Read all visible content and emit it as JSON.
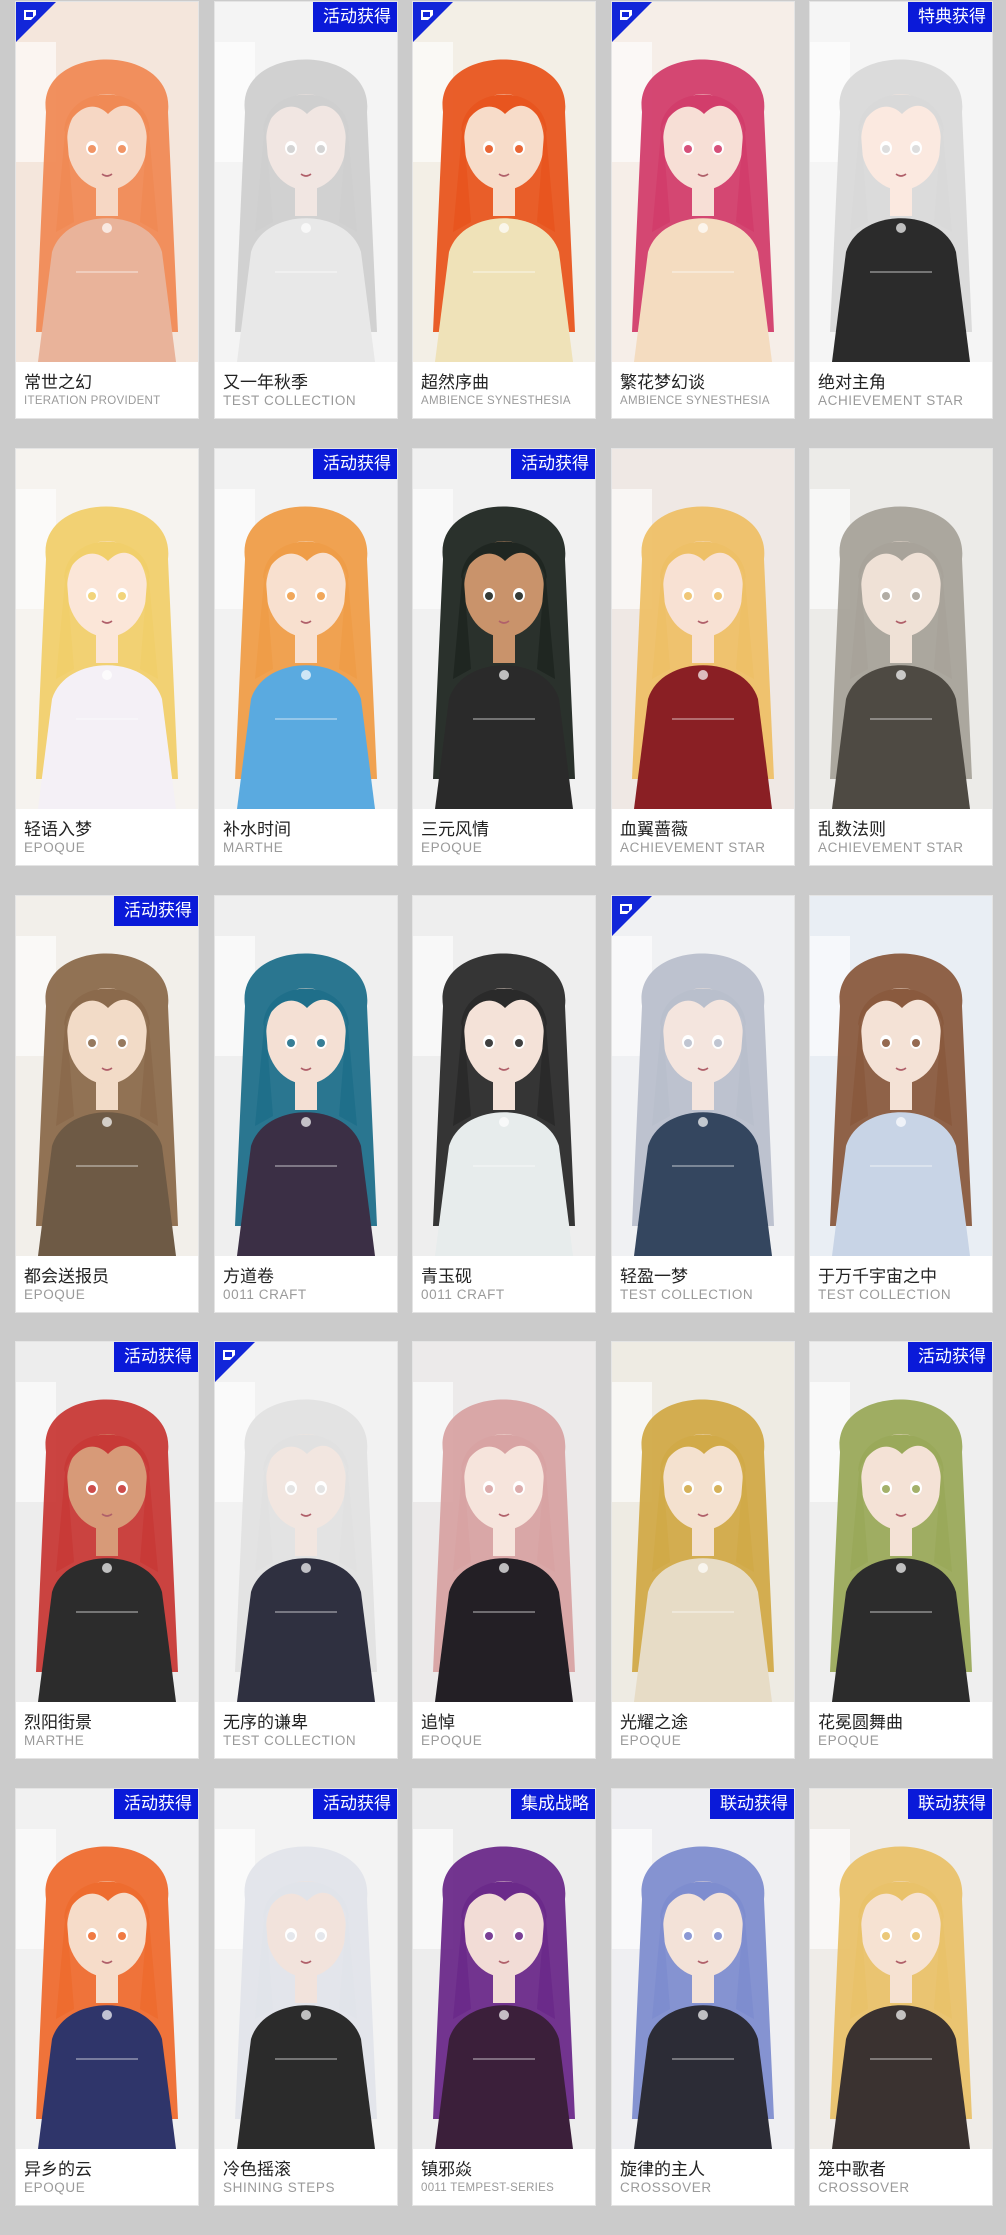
{
  "badges": {
    "event": "活动获得",
    "classic": "特典获得",
    "integrated": "集成战略",
    "collab": "联动获得"
  },
  "cards": [
    {
      "name": "常世之幻",
      "brand": "ITERATION PROVIDENT",
      "badge": "",
      "corner": true,
      "hair": "#f08a55",
      "skin": "#f6d7c4",
      "outfit": "#e9b39a",
      "bg": "#f4e6dc"
    },
    {
      "name": "又一年秋季",
      "brand": "TEST COLLECTION",
      "badge": "event",
      "corner": false,
      "hair": "#cfcfcf",
      "skin": "#f1e6e2",
      "outfit": "#e8e8e8",
      "bg": "#f4f4f4"
    },
    {
      "name": "超然序曲",
      "brand": "AMBIENCE SYNESTHESIA",
      "badge": "",
      "corner": true,
      "hair": "#e8551f",
      "skin": "#f7dcc9",
      "outfit": "#efe2b8",
      "bg": "#f3efe6"
    },
    {
      "name": "繁花梦幻谈",
      "brand": "AMBIENCE SYNESTHESIA",
      "badge": "",
      "corner": true,
      "hair": "#d23d6b",
      "skin": "#f7dfd6",
      "outfit": "#f4dcc0",
      "bg": "#f6eee8"
    },
    {
      "name": "绝对主角",
      "brand": "ACHIEVEMENT STAR",
      "badge": "classic",
      "corner": false,
      "hair": "#d9d9d9",
      "skin": "#fbe9e0",
      "outfit": "#2b2b2b",
      "bg": "#f5f5f5"
    },
    {
      "name": "轻语入梦",
      "brand": "EPOQUE",
      "badge": "",
      "corner": false,
      "hair": "#f1cf6b",
      "skin": "#fbe6d8",
      "outfit": "#f4f0f6",
      "bg": "#f6f3ef"
    },
    {
      "name": "补水时间",
      "brand": "MARTHE",
      "badge": "event",
      "corner": false,
      "hair": "#ef9d48",
      "skin": "#f8e0cf",
      "outfit": "#5aaae0",
      "bg": "#f2f2f2"
    },
    {
      "name": "三元风情",
      "brand": "EPOQUE",
      "badge": "event",
      "corner": false,
      "hair": "#1f2621",
      "skin": "#c9936b",
      "outfit": "#2a2a2a",
      "bg": "#f1f1f1"
    },
    {
      "name": "血翼蔷薇",
      "brand": "ACHIEVEMENT STAR",
      "badge": "",
      "corner": false,
      "hair": "#eec067",
      "skin": "#f8e1d3",
      "outfit": "#8a1f24",
      "bg": "#efe8e4"
    },
    {
      "name": "乱数法则",
      "brand": "ACHIEVEMENT STAR",
      "badge": "",
      "corner": false,
      "hair": "#a8a39a",
      "skin": "#efe1d6",
      "outfit": "#4e4a43",
      "bg": "#ecebe8"
    },
    {
      "name": "都会送报员",
      "brand": "EPOQUE",
      "badge": "event",
      "corner": false,
      "hair": "#8b6a4c",
      "skin": "#f2dbc7",
      "outfit": "#6e5a45",
      "bg": "#f2efea"
    },
    {
      "name": "方道卷",
      "brand": "0011 CRAFT",
      "badge": "",
      "corner": false,
      "hair": "#1f6f8a",
      "skin": "#f4e0d4",
      "outfit": "#3b2f45",
      "bg": "#efefef"
    },
    {
      "name": "青玉砚",
      "brand": "0011 CRAFT",
      "badge": "",
      "corner": false,
      "hair": "#2a2a2a",
      "skin": "#f4e2d8",
      "outfit": "#e7ecec",
      "bg": "#eeeeee"
    },
    {
      "name": "轻盈一梦",
      "brand": "TEST COLLECTION",
      "badge": "",
      "corner": true,
      "hair": "#b9bfcc",
      "skin": "#f4e5de",
      "outfit": "#34465f",
      "bg": "#f0f1f3"
    },
    {
      "name": "于万千宇宙之中",
      "brand": "TEST COLLECTION",
      "badge": "",
      "corner": false,
      "hair": "#8a5a3e",
      "skin": "#f4e2d6",
      "outfit": "#c8d4e6",
      "bg": "#e9eef4"
    },
    {
      "name": "烈阳街景",
      "brand": "MARTHE",
      "badge": "event",
      "corner": false,
      "hair": "#c83a37",
      "skin": "#d79a78",
      "outfit": "#2c2c2c",
      "bg": "#ededed"
    },
    {
      "name": "无序的谦卑",
      "brand": "TEST COLLECTION",
      "badge": "",
      "corner": true,
      "hair": "#e1e1e1",
      "skin": "#f2e6e0",
      "outfit": "#2f3040",
      "bg": "#f2f2f2"
    },
    {
      "name": "追悼",
      "brand": "EPOQUE",
      "badge": "",
      "corner": false,
      "hair": "#d8a3a3",
      "skin": "#f6e4dc",
      "outfit": "#231f25",
      "bg": "#eceaea"
    },
    {
      "name": "光耀之途",
      "brand": "EPOQUE",
      "badge": "",
      "corner": false,
      "hair": "#d1aa48",
      "skin": "#f4e1cf",
      "outfit": "#e7dcc6",
      "bg": "#eeebe3"
    },
    {
      "name": "花冕圆舞曲",
      "brand": "EPOQUE",
      "badge": "event",
      "corner": false,
      "hair": "#9aa95a",
      "skin": "#f4e2d6",
      "outfit": "#2c2c2c",
      "bg": "#efefef"
    },
    {
      "name": "异乡的云",
      "brand": "EPOQUE",
      "badge": "event",
      "corner": false,
      "hair": "#ee6c2f",
      "skin": "#f6dcc9",
      "outfit": "#2f356a",
      "bg": "#f1f1f1"
    },
    {
      "name": "冷色摇滚",
      "brand": "SHINING STEPS",
      "badge": "event",
      "corner": false,
      "hair": "#e1e4ea",
      "skin": "#f2e3dc",
      "outfit": "#2b2b2b",
      "bg": "#f3f3f3"
    },
    {
      "name": "镇邪焱",
      "brand": "0011 TEMPEST-SERIES",
      "badge": "integrated",
      "corner": false,
      "hair": "#6b2a8a",
      "skin": "#f2dcd6",
      "outfit": "#3b1f3a",
      "bg": "#ededed"
    },
    {
      "name": "旋律的主人",
      "brand": "CROSSOVER",
      "badge": "collab",
      "corner": false,
      "hair": "#7e8dcf",
      "skin": "#f3e2d8",
      "outfit": "#2c2c36",
      "bg": "#efeff2"
    },
    {
      "name": "笼中歌者",
      "brand": "CROSSOVER",
      "badge": "collab",
      "corner": false,
      "hair": "#e9c26a",
      "skin": "#f6e2d2",
      "outfit": "#3a3230",
      "bg": "#efece8"
    }
  ]
}
